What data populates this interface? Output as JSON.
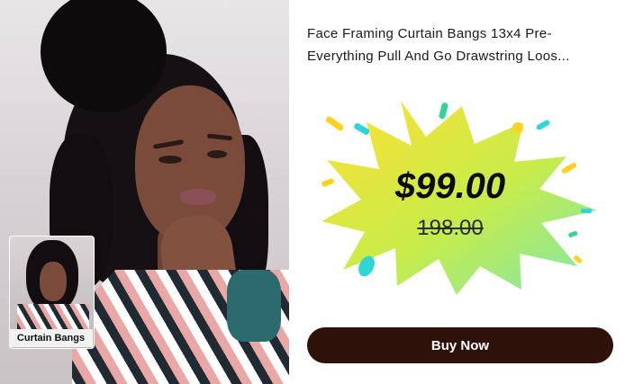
{
  "product": {
    "title_line1": "Face Framing Curtain Bangs 13x4 Pre-",
    "title_line2": "Everything Pull And Go Drawstring Loos..."
  },
  "price": {
    "current": "$99.00",
    "original": "198.00"
  },
  "thumbnail": {
    "label": "Curtain Bangs"
  },
  "cta": {
    "buy_label": "Buy Now"
  },
  "colors": {
    "button_bg": "#2e1209",
    "burst_start": "#ffe033",
    "burst_end": "#7ee6b0"
  }
}
